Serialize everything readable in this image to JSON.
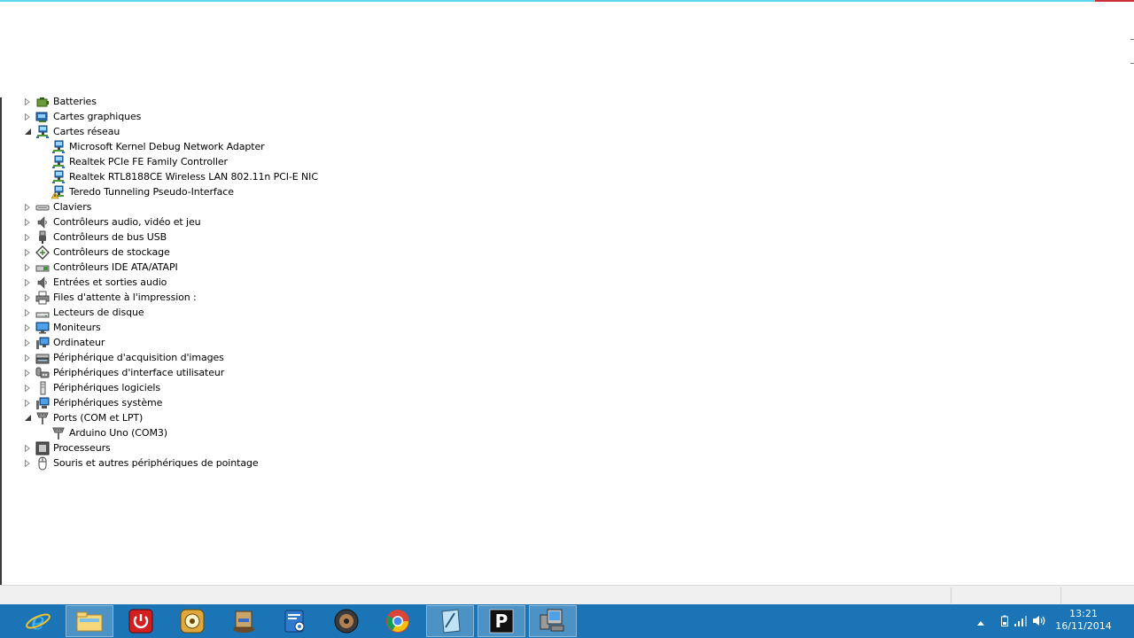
{
  "tree": {
    "items": [
      {
        "label": "Batteries",
        "level": 0,
        "state": "collapsed",
        "icon": "battery-icon"
      },
      {
        "label": "Cartes graphiques",
        "level": 0,
        "state": "collapsed",
        "icon": "display-adapter-icon"
      },
      {
        "label": "Cartes réseau",
        "level": 0,
        "state": "expanded",
        "icon": "network-adapter-icon"
      },
      {
        "label": "Microsoft Kernel Debug Network Adapter",
        "level": 1,
        "state": "leaf",
        "icon": "network-adapter-icon"
      },
      {
        "label": "Realtek PCIe FE Family Controller",
        "level": 1,
        "state": "leaf",
        "icon": "network-adapter-icon"
      },
      {
        "label": "Realtek RTL8188CE Wireless LAN 802.11n PCI-E NIC",
        "level": 1,
        "state": "leaf",
        "icon": "network-adapter-icon"
      },
      {
        "label": "Teredo Tunneling Pseudo-Interface",
        "level": 1,
        "state": "leaf",
        "icon": "network-adapter-warning-icon"
      },
      {
        "label": "Claviers",
        "level": 0,
        "state": "collapsed",
        "icon": "keyboard-icon"
      },
      {
        "label": "Contrôleurs audio, vidéo et jeu",
        "level": 0,
        "state": "collapsed",
        "icon": "speaker-icon"
      },
      {
        "label": "Contrôleurs de bus USB",
        "level": 0,
        "state": "collapsed",
        "icon": "usb-plug-icon"
      },
      {
        "label": "Contrôleurs de stockage",
        "level": 0,
        "state": "collapsed",
        "icon": "storage-controller-icon"
      },
      {
        "label": "Contrôleurs IDE ATA/ATAPI",
        "level": 0,
        "state": "collapsed",
        "icon": "ide-controller-icon"
      },
      {
        "label": "Entrées et sorties audio",
        "level": 0,
        "state": "collapsed",
        "icon": "speaker-icon"
      },
      {
        "label": "Files d'attente à l'impression :",
        "level": 0,
        "state": "collapsed",
        "icon": "printer-icon"
      },
      {
        "label": "Lecteurs de disque",
        "level": 0,
        "state": "collapsed",
        "icon": "disk-drive-icon"
      },
      {
        "label": "Moniteurs",
        "level": 0,
        "state": "collapsed",
        "icon": "monitor-icon"
      },
      {
        "label": "Ordinateur",
        "level": 0,
        "state": "collapsed",
        "icon": "computer-icon"
      },
      {
        "label": "Périphérique d'acquisition d'images",
        "level": 0,
        "state": "collapsed",
        "icon": "scanner-icon"
      },
      {
        "label": "Périphériques d'interface utilisateur",
        "level": 0,
        "state": "collapsed",
        "icon": "hid-icon"
      },
      {
        "label": "Périphériques logiciels",
        "level": 0,
        "state": "collapsed",
        "icon": "software-device-icon"
      },
      {
        "label": "Périphériques système",
        "level": 0,
        "state": "collapsed",
        "icon": "system-device-icon"
      },
      {
        "label": "Ports (COM et LPT)",
        "level": 0,
        "state": "expanded",
        "icon": "port-icon"
      },
      {
        "label": "Arduino Uno (COM3)",
        "level": 1,
        "state": "leaf",
        "icon": "port-icon"
      },
      {
        "label": "Processeurs",
        "level": 0,
        "state": "collapsed",
        "icon": "processor-icon"
      },
      {
        "label": "Souris et autres périphériques de pointage",
        "level": 0,
        "state": "collapsed",
        "icon": "mouse-icon"
      }
    ]
  },
  "taskbar": {
    "apps": [
      {
        "name": "internet-explorer-button",
        "icon": "internet-explorer-icon",
        "state": "normal"
      },
      {
        "name": "file-explorer-button",
        "icon": "file-explorer-icon",
        "state": "pinned-active"
      },
      {
        "name": "shutdown-app-button",
        "icon": "power-icon",
        "state": "normal"
      },
      {
        "name": "media-app-button",
        "icon": "media-app-icon",
        "state": "normal"
      },
      {
        "name": "document-app-button",
        "icon": "document-app-icon",
        "state": "normal"
      },
      {
        "name": "control-panel-button",
        "icon": "control-panel-icon",
        "state": "normal"
      },
      {
        "name": "speaker-app-button",
        "icon": "speaker-app-icon",
        "state": "normal"
      },
      {
        "name": "chrome-button",
        "icon": "chrome-icon",
        "state": "normal"
      },
      {
        "name": "notepad-button",
        "icon": "notepad-icon",
        "state": "pinned-active"
      },
      {
        "name": "p-app-button",
        "icon": "p-app-icon",
        "state": "pinned-active",
        "letter": "P"
      },
      {
        "name": "device-manager-button",
        "icon": "device-manager-icon",
        "state": "pinned-active"
      }
    ],
    "clock": {
      "time": "13:21",
      "date": "16/11/2014"
    }
  },
  "colors": {
    "taskbar": "#1a74b5",
    "accent_top": "#5fd6ef",
    "close_accent": "#c8303a"
  }
}
